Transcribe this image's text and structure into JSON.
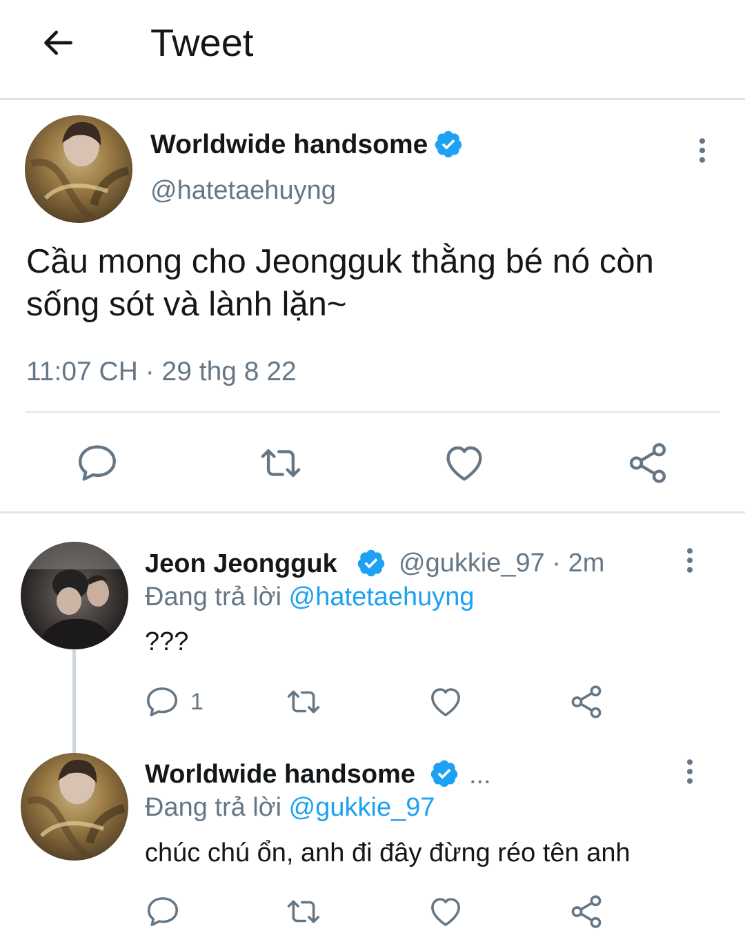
{
  "header": {
    "title": "Tweet",
    "back_icon": "arrow-left-icon"
  },
  "colors": {
    "accent": "#1da1f2",
    "secondary_text": "#657786",
    "primary_text": "#14171a",
    "divider": "#e1e8ed"
  },
  "main_tweet": {
    "display_name": "Worldwide handsome",
    "handle": "@hatetaehuyng",
    "verified": true,
    "text": "Cầu mong cho Jeongguk thằng bé nó còn sống sót và lành lặn~",
    "timestamp": "11:07 CH · 29 thg 8 22",
    "actions": [
      "reply-icon",
      "retweet-icon",
      "like-icon",
      "share-icon"
    ]
  },
  "replies": [
    {
      "display_name": "Jeon Jeongguk",
      "handle_time": "@gukkie_97 · 2m",
      "verified": true,
      "replying_prefix": "Đang trả lời ",
      "replying_to": "@hatetaehuyng",
      "text": "???",
      "reply_count": "1"
    },
    {
      "display_name": "Worldwide handsome",
      "handle_time": "...",
      "verified": true,
      "replying_prefix": "Đang trả lời ",
      "replying_to": "@gukkie_97",
      "text": "chúc chú ổn, anh đi đây đừng réo tên anh",
      "reply_count": ""
    }
  ]
}
